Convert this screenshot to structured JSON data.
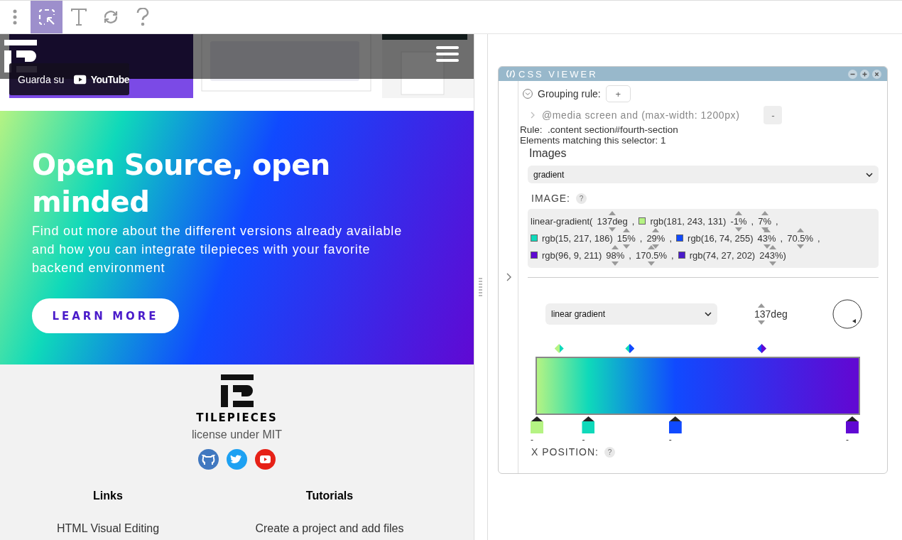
{
  "toolbar": {
    "tools": [
      {
        "kind": "select",
        "selected": true
      },
      {
        "kind": "text",
        "selected": false
      },
      {
        "kind": "refresh",
        "selected": false
      },
      {
        "kind": "help",
        "selected": false
      }
    ]
  },
  "video": {
    "kind": "picture",
    "watch_label": "Guarda su",
    "platform": "YouTube"
  },
  "hero": {
    "title": "Open Source, open minded",
    "text": "Find out more about the different versions already available and how you can integrate tilepieces with your favorite backend environment",
    "button": "LEARN MORE"
  },
  "footer": {
    "brand": "TILEPIECES",
    "license": "license under MIT",
    "social": [
      {
        "kind": "github",
        "color": "#4078c0"
      },
      {
        "kind": "twitter",
        "color": "#1da1f2"
      },
      {
        "kind": "youtube",
        "color": "#e62117"
      }
    ],
    "columns": [
      {
        "heading": "Links",
        "items": [
          "HTML Visual Editing"
        ]
      },
      {
        "heading": "Tutorials",
        "items": [
          "Create a project and add files"
        ]
      }
    ]
  },
  "css_viewer": {
    "title": "CSS VIEWER",
    "grouping_label": "Grouping rule:",
    "add_button": "+",
    "grouping_expanded": true,
    "media_query": "@media screen and (max-width: 1200px)",
    "remove_button": "-",
    "rule": "Rule:  .content section#fourth-section",
    "matching": "Elements matching this selector: 1",
    "section_heading": "Images",
    "image_type": "gradient",
    "image_label": "IMAGE:",
    "help": "?",
    "gradient_lines": [
      [
        {
          "kind": "plain",
          "text": "linear-gradient("
        },
        {
          "kind": "spin",
          "text": "137deg"
        },
        {
          "kind": "plain",
          "text": ","
        },
        {
          "kind": "swatch",
          "text": "rgb(181, 243, 131)",
          "color": "#b5f383"
        },
        {
          "kind": "spin",
          "text": "-1%"
        },
        {
          "kind": "plain",
          "text": ","
        },
        {
          "kind": "spin",
          "text": "7%"
        },
        {
          "kind": "plain",
          "text": ","
        }
      ],
      [
        {
          "kind": "swatch",
          "text": "rgb(15, 217, 186)",
          "color": "#0fd9ba"
        },
        {
          "kind": "spin",
          "text": "15%"
        },
        {
          "kind": "plain",
          "text": ","
        },
        {
          "kind": "spin",
          "text": "29%"
        },
        {
          "kind": "plain",
          "text": ","
        },
        {
          "kind": "swatch",
          "text": "rgb(16, 74, 255)",
          "color": "#104aff"
        },
        {
          "kind": "spin",
          "text": "43%"
        },
        {
          "kind": "plain",
          "text": ","
        },
        {
          "kind": "spin",
          "text": "70.5%"
        },
        {
          "kind": "plain",
          "text": ","
        }
      ],
      [
        {
          "kind": "swatch",
          "text": "rgb(96, 9, 211)",
          "color": "#6009d3"
        },
        {
          "kind": "spin",
          "text": "98%"
        },
        {
          "kind": "plain",
          "text": ","
        },
        {
          "kind": "spin",
          "text": "170.5%"
        },
        {
          "kind": "plain",
          "text": ","
        },
        {
          "kind": "swatch",
          "text": "rgb(74, 27, 202)",
          "color": "#4a1bca"
        },
        {
          "kind": "spin",
          "text": "243%)"
        }
      ]
    ],
    "gradient_type": "linear gradient",
    "angle": "137deg",
    "stops": [
      {
        "color": "#b5f383",
        "level": 0,
        "label": "-"
      },
      {
        "color": "#0fd9ba",
        "level": 0.16,
        "label": "-"
      },
      {
        "color": "#104aff",
        "level": 0.43,
        "label": "-"
      },
      {
        "color": "#6009d3",
        "level": 0.98,
        "label": "-"
      }
    ],
    "midpoints": [
      {
        "level": 0.07
      },
      {
        "level": 0.29
      },
      {
        "level": 0.7
      }
    ],
    "next_label": "X POSITION:",
    "next_help": "?"
  }
}
